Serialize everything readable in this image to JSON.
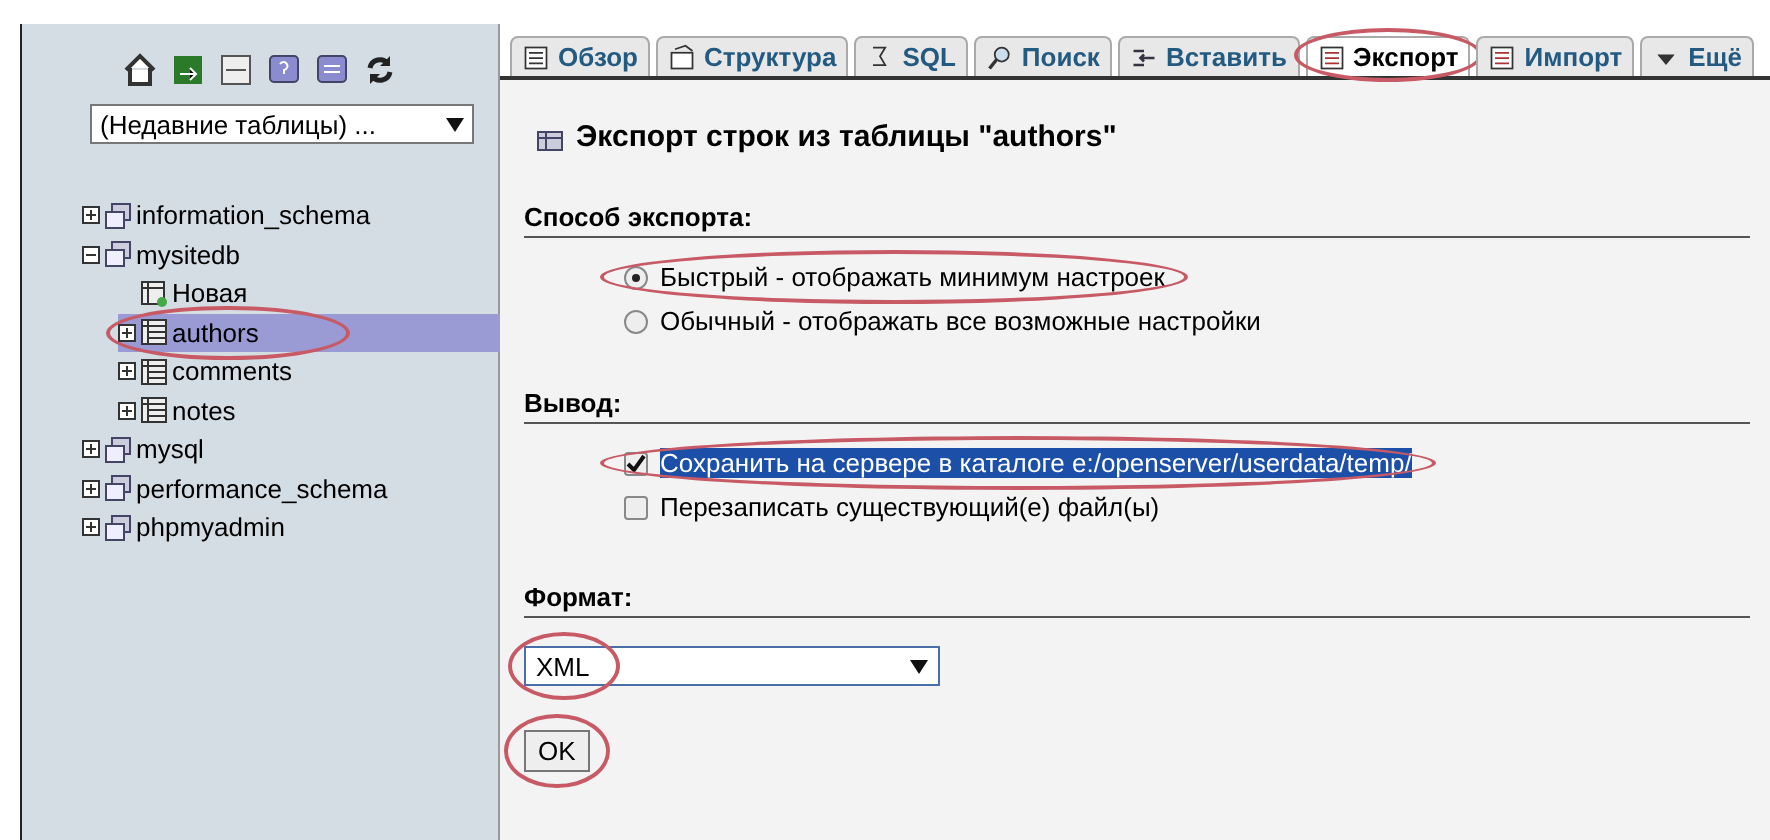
{
  "sidebar": {
    "recent_tables": {
      "value": "(Недавние таблицы) ..."
    },
    "tree": [
      {
        "label": "information_schema",
        "kind": "db",
        "expanded": false,
        "selected": false,
        "circled": false
      },
      {
        "label": "mysitedb",
        "kind": "db",
        "expanded": true,
        "selected": false,
        "circled": false,
        "children": [
          {
            "label": "Новая",
            "kind": "new",
            "selected": false,
            "circled": false
          },
          {
            "label": "authors",
            "kind": "table",
            "expanded": false,
            "selected": true,
            "circled": true
          },
          {
            "label": "comments",
            "kind": "table",
            "expanded": false,
            "selected": false,
            "circled": false
          },
          {
            "label": "notes",
            "kind": "table",
            "expanded": false,
            "selected": false,
            "circled": false
          }
        ]
      },
      {
        "label": "mysql",
        "kind": "db",
        "expanded": false,
        "selected": false,
        "circled": false
      },
      {
        "label": "performance_schema",
        "kind": "db",
        "expanded": false,
        "selected": false,
        "circled": false
      },
      {
        "label": "phpmyadmin",
        "kind": "db",
        "expanded": false,
        "selected": false,
        "circled": false
      }
    ]
  },
  "tabs": [
    {
      "label": "Обзор",
      "selected": false,
      "circled": false
    },
    {
      "label": "Структура",
      "selected": false,
      "circled": false
    },
    {
      "label": "SQL",
      "selected": false,
      "circled": false
    },
    {
      "label": "Поиск",
      "selected": false,
      "circled": false
    },
    {
      "label": "Вставить",
      "selected": false,
      "circled": false
    },
    {
      "label": "Экспорт",
      "selected": true,
      "circled": true
    },
    {
      "label": "Импорт",
      "selected": false,
      "circled": false
    },
    {
      "label": "Ещё",
      "selected": false,
      "circled": false
    }
  ],
  "heading": "Экспорт строк из таблицы \"authors\"",
  "export_method": {
    "title": "Способ экспорта:",
    "options": [
      {
        "label": "Быстрый - отображать минимум настроек",
        "selected": true,
        "circled": true
      },
      {
        "label": "Обычный - отображать все возможные настройки",
        "selected": false,
        "circled": false
      }
    ]
  },
  "output": {
    "title": "Вывод:",
    "options": [
      {
        "label": "Сохранить на сервере в каталоге e:/openserver/userdata/temp/",
        "checked": true,
        "highlighted": true,
        "circled": true
      },
      {
        "label": "Перезаписать существующий(е) файл(ы)",
        "checked": false,
        "highlighted": false,
        "circled": false
      }
    ]
  },
  "format": {
    "title": "Формат:",
    "value": "XML",
    "circled": true
  },
  "ok_button": {
    "label": "OK",
    "circled": true
  }
}
